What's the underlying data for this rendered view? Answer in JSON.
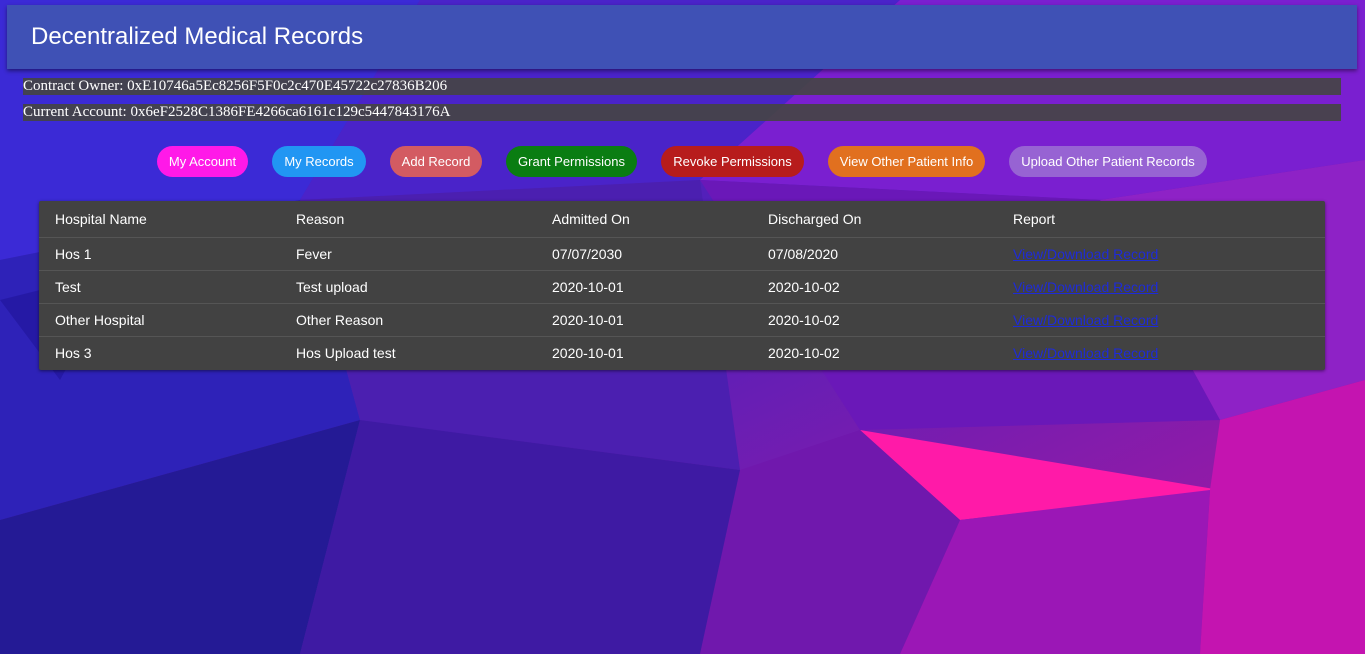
{
  "app": {
    "title": "Decentralized Medical Records"
  },
  "accounts": {
    "owner_text": "Contract Owner: 0xE10746a5Ec8256F5F0c2c470E45722c27836B206",
    "current_text": "Current Account: 0x6eF2528C1386FE4266ca6161c129c5447843176A"
  },
  "nav": {
    "buttons": [
      {
        "label": "My Account",
        "color": "#ff19e8"
      },
      {
        "label": "My Records",
        "color": "#2196f3"
      },
      {
        "label": "Add Record",
        "color": "#d35b62"
      },
      {
        "label": "Grant Permissions",
        "color": "#0a7d12"
      },
      {
        "label": "Revoke Permissions",
        "color": "#b71c1c"
      },
      {
        "label": "View Other Patient Info",
        "color": "#e1701f"
      },
      {
        "label": "Upload Other Patient Records",
        "color": "#9763d3"
      }
    ]
  },
  "records": {
    "columns": [
      "Hospital Name",
      "Reason",
      "Admitted On",
      "Discharged On",
      "Report"
    ],
    "rows": [
      {
        "hospital": "Hos 1",
        "reason": "Fever",
        "admitted": "07/07/2030",
        "discharged": "07/08/2020",
        "report": "View/Download Record"
      },
      {
        "hospital": "Test",
        "reason": "Test upload",
        "admitted": "2020-10-01",
        "discharged": "2020-10-02",
        "report": "View/Download Record"
      },
      {
        "hospital": "Other Hospital",
        "reason": "Other Reason",
        "admitted": "2020-10-01",
        "discharged": "2020-10-02",
        "report": "View/Download Record"
      },
      {
        "hospital": "Hos 3",
        "reason": "Hos Upload test",
        "admitted": "2020-10-01",
        "discharged": "2020-10-02",
        "report": "View/Download Record"
      }
    ]
  },
  "colors": {
    "appbar": "#3f51b5",
    "table_bg": "#424242",
    "link": "#1e2bd8"
  }
}
